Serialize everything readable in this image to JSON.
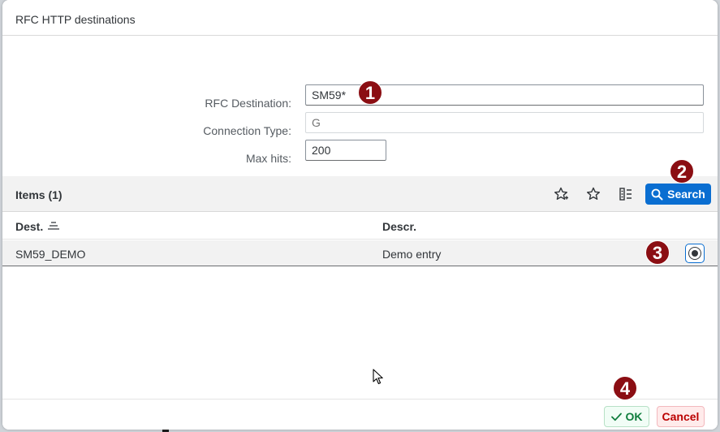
{
  "dialog": {
    "title": "RFC HTTP destinations"
  },
  "form": {
    "rfc_destination_label": "RFC Destination:",
    "rfc_destination_value": "SM59*",
    "connection_type_label": "Connection Type:",
    "connection_type_placeholder": "G",
    "max_hits_label": "Max hits:",
    "max_hits_value": "200"
  },
  "toolbar": {
    "items_title": "Items (1)",
    "search_label": "Search"
  },
  "table": {
    "columns": [
      "Dest.",
      "Descr."
    ],
    "rows": [
      {
        "dest": "SM59_DEMO",
        "descr": "Demo entry",
        "selected": true
      }
    ]
  },
  "footer": {
    "ok_label": "OK",
    "cancel_label": "Cancel"
  },
  "badges": [
    "1",
    "2",
    "3",
    "4"
  ],
  "colors": {
    "accent": "#0a6ed1",
    "badge": "#8b0e13",
    "ok_text": "#107e3e",
    "cancel_text": "#bb0000"
  }
}
